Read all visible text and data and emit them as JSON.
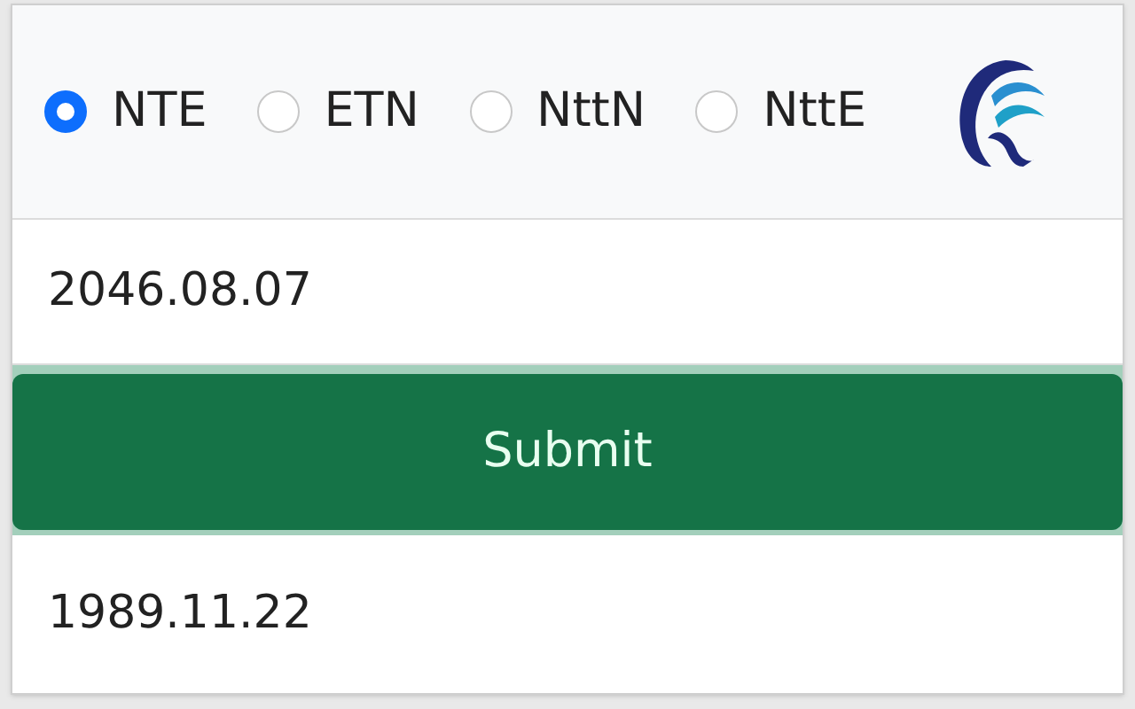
{
  "modes": [
    {
      "label": "NTE",
      "selected": true
    },
    {
      "label": "ETN",
      "selected": false
    },
    {
      "label": "NttN",
      "selected": false
    },
    {
      "label": "NttE",
      "selected": false
    }
  ],
  "date_input": {
    "value": "2046.08.07"
  },
  "submit_button": {
    "label": "Submit"
  },
  "result": {
    "value": "1989.11.22"
  }
}
